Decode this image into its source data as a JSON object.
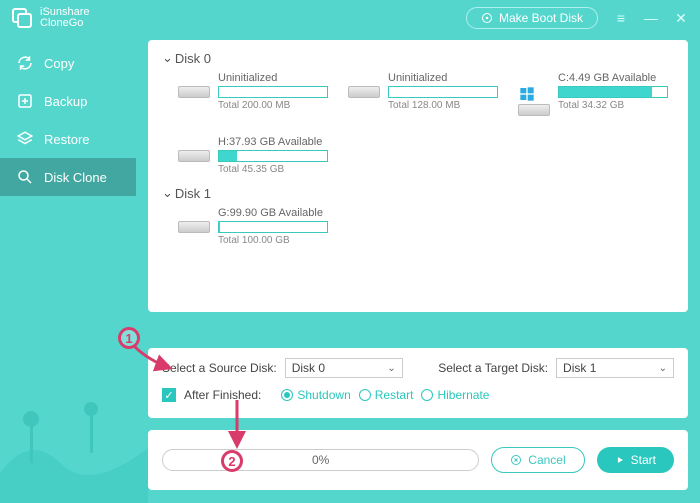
{
  "brand": {
    "line1": "iSunshare",
    "line2": "CloneGo"
  },
  "topbar": {
    "make_boot_disk": "Make Boot Disk"
  },
  "sidebar": {
    "copy": "Copy",
    "backup": "Backup",
    "restore": "Restore",
    "disk_clone": "Disk Clone"
  },
  "disks": {
    "groups": [
      {
        "title": "Disk 0",
        "partitions": [
          {
            "label": "Uninitialized",
            "total": "Total 200.00 MB",
            "fill_pct": 0,
            "os": false
          },
          {
            "label": "Uninitialized",
            "total": "Total 128.00 MB",
            "fill_pct": 0,
            "os": false
          },
          {
            "label": "C:4.49 GB Available",
            "total": "Total 34.32 GB",
            "fill_pct": 86,
            "os": true
          },
          {
            "label": "H:37.93 GB Available",
            "total": "Total 45.35 GB",
            "fill_pct": 17,
            "os": false
          }
        ]
      },
      {
        "title": "Disk 1",
        "partitions": [
          {
            "label": "G:99.90 GB Available",
            "total": "Total 100.00 GB",
            "fill_pct": 1,
            "os": false
          }
        ]
      }
    ]
  },
  "options": {
    "source_label": "Select a Source Disk:",
    "target_label": "Select a Target Disk:",
    "source_value": "Disk 0",
    "target_value": "Disk 1",
    "after_finished_label": "After Finished:",
    "radios": {
      "shutdown": "Shutdown",
      "restart": "Restart",
      "hibernate": "Hibernate"
    },
    "selected_radio": "shutdown"
  },
  "progress": {
    "text": "0%",
    "cancel": "Cancel",
    "start": "Start"
  },
  "markers": {
    "one": "1",
    "two": "2"
  }
}
